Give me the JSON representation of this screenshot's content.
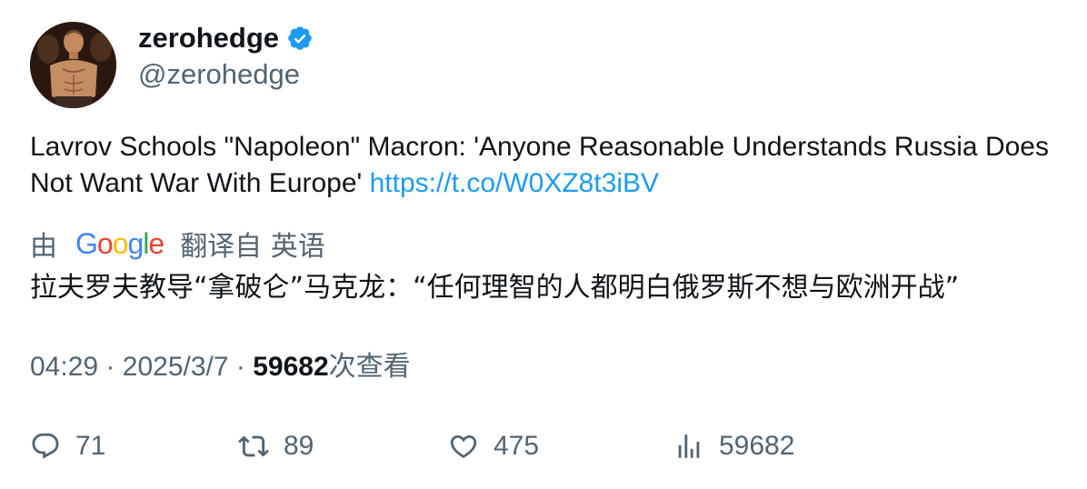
{
  "author": {
    "display_name": "zerohedge",
    "handle": "@zerohedge",
    "verified_icon": "verified-badge-icon"
  },
  "tweet": {
    "text": "Lavrov Schools \"Napoleon\" Macron: 'Anyone Reasonable Understands Russia Does Not Want War With Europe' ",
    "link": "https://t.co/W0XZ8t3iBV"
  },
  "translation": {
    "prefix": "由",
    "provider_logo": "Google",
    "suffix": "翻译自 英语",
    "text": "拉夫罗夫教导“拿破仑”马克龙：“任何理智的人都明白俄罗斯不想与欧洲开战”"
  },
  "meta": {
    "time": "04:29",
    "separator": "·",
    "date": "2025/3/7",
    "views_count": "59682",
    "views_label": "次查看"
  },
  "actions": {
    "reply": {
      "icon": "reply-icon",
      "count": "71"
    },
    "retweet": {
      "icon": "retweet-icon",
      "count": "89"
    },
    "like": {
      "icon": "heart-icon",
      "count": "475"
    },
    "views": {
      "icon": "bar-chart-icon",
      "count": "59682"
    }
  },
  "colors": {
    "text": "#0f1419",
    "secondary": "#536471",
    "link": "#1d9bf0",
    "verified": "#1d9bf0"
  }
}
